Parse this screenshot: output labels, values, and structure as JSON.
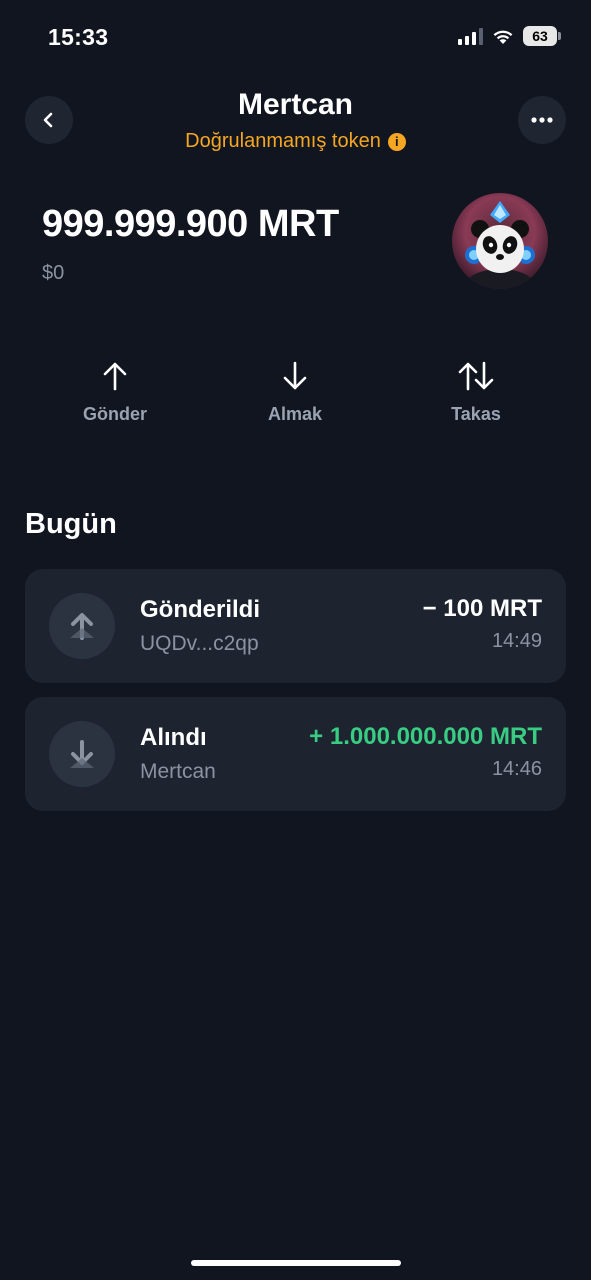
{
  "status_bar": {
    "time": "15:33",
    "battery": "63",
    "signal_icon": "cellular-signal-icon",
    "wifi_icon": "wifi-icon"
  },
  "header": {
    "title": "Mertcan",
    "subtitle": "Doğrulanmamış token",
    "back_icon": "chevron-left-icon",
    "more_icon": "more-horizontal-icon",
    "info_icon": "info-icon",
    "info_glyph": "i"
  },
  "token": {
    "balance": "999.999.900 MRT",
    "fiat_value": "$0",
    "avatar": "panda-token-logo"
  },
  "actions": [
    {
      "label": "Gönder",
      "icon": "arrow-up-icon"
    },
    {
      "label": "Almak",
      "icon": "arrow-down-icon"
    },
    {
      "label": "Takas",
      "icon": "swap-arrows-icon"
    }
  ],
  "history": {
    "section_title": "Bugün",
    "transactions": [
      {
        "title": "Gönderildi",
        "counterparty": "UQDv...c2qp",
        "amount": "− 100 MRT",
        "time": "14:49",
        "direction": "out"
      },
      {
        "title": "Alındı",
        "counterparty": "Mertcan",
        "amount": "+ 1.000.000.000 MRT",
        "time": "14:46",
        "direction": "in"
      }
    ]
  },
  "colors": {
    "background": "#10151f",
    "card": "#1d2430",
    "warning": "#f5a623",
    "positive": "#39cc83",
    "muted": "#8b93a1"
  }
}
